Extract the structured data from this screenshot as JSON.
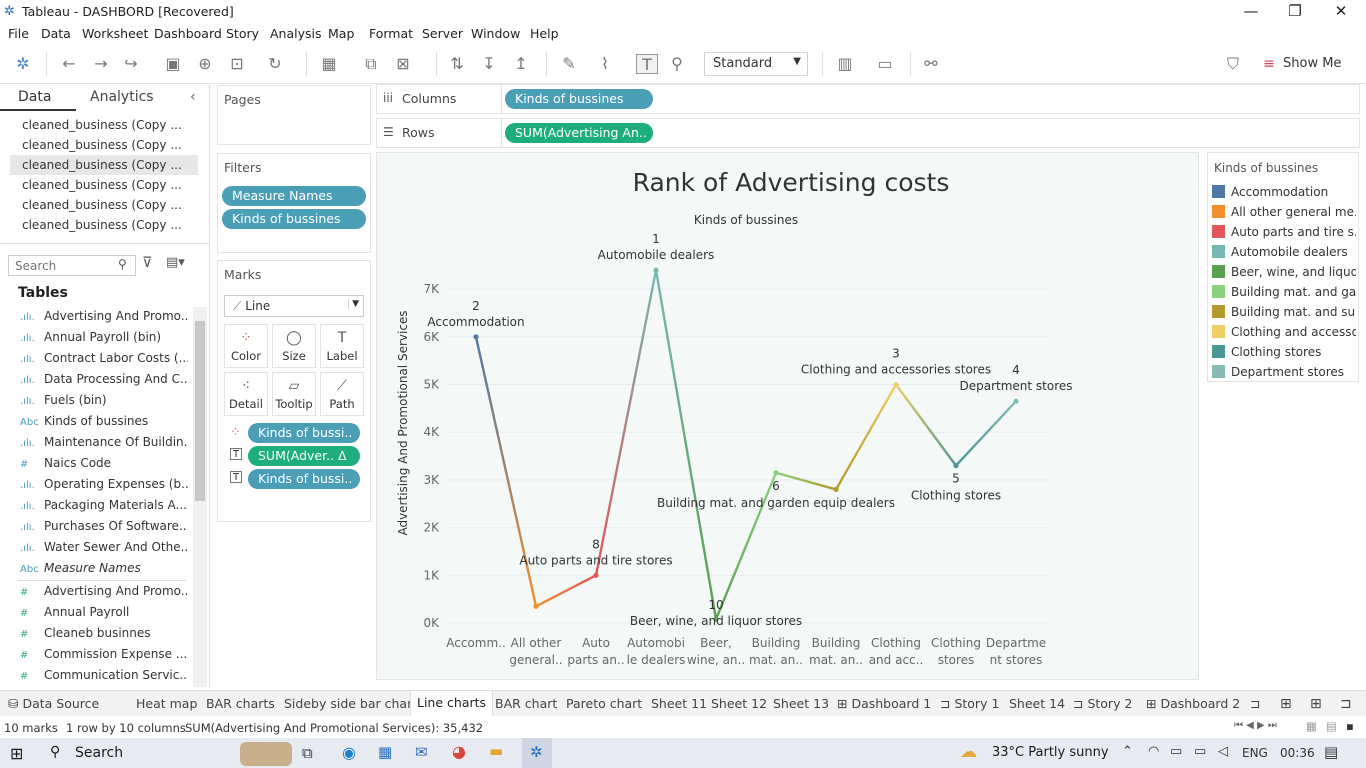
{
  "window": {
    "title": "Tableau - DASHBORD [Recovered]",
    "min": "—",
    "restore": "❐",
    "close": "✕"
  },
  "menu": [
    "File",
    "Data",
    "Worksheet",
    "Dashboard",
    "Story",
    "Analysis",
    "Map",
    "Format",
    "Server",
    "Window",
    "Help"
  ],
  "toolbar": {
    "fit": "Standard",
    "show_me": "Show Me"
  },
  "left": {
    "tab_data": "Data",
    "tab_analytics": "Analytics",
    "datasources": [
      "cleaned_business (Copy ...",
      "cleaned_business (Copy ...",
      "cleaned_business (Copy ...",
      "cleaned_business (Copy ...",
      "cleaned_business (Copy ...",
      "cleaned_business (Copy ..."
    ],
    "search_placeholder": "Search",
    "tables_heading": "Tables",
    "fields": [
      {
        "icon": ".ılı.",
        "label": "Advertising And Promo..."
      },
      {
        "icon": ".ılı.",
        "label": "Annual Payroll (bin)"
      },
      {
        "icon": ".ılı.",
        "label": "Contract Labor Costs (..."
      },
      {
        "icon": ".ılı.",
        "label": "Data Processing And C..."
      },
      {
        "icon": ".ılı.",
        "label": "Fuels (bin)"
      },
      {
        "icon": "Abc",
        "label": "Kinds of bussines"
      },
      {
        "icon": ".ılı.",
        "label": "Maintenance Of Buildin..."
      },
      {
        "icon": "#",
        "label": "Naics Code"
      },
      {
        "icon": ".ılı.",
        "label": "Operating Expenses (b..."
      },
      {
        "icon": ".ılı.",
        "label": "Packaging Materials A..."
      },
      {
        "icon": ".ılı.",
        "label": "Purchases Of Software..."
      },
      {
        "icon": ".ılı.",
        "label": "Water Sewer And Othe..."
      },
      {
        "icon": "Abc",
        "label": "Measure Names"
      }
    ],
    "measures": [
      {
        "icon": "#",
        "label": "Advertising And Promo..."
      },
      {
        "icon": "#",
        "label": "Annual Payroll"
      },
      {
        "icon": "#",
        "label": "Cleaneb businnes"
      },
      {
        "icon": "#",
        "label": "Commission Expense ..."
      },
      {
        "icon": "#",
        "label": "Communication Servic..."
      }
    ]
  },
  "cards": {
    "pages": "Pages",
    "filters": "Filters",
    "filter_pills": [
      "Measure Names",
      "Kinds of bussines"
    ],
    "marks": "Marks",
    "mark_type": "Line",
    "mark_buttons": [
      "Color",
      "Size",
      "Label",
      "Detail",
      "Tooltip",
      "Path"
    ],
    "mark_pills": [
      "Kinds of bussi..",
      "SUM(Adver..  Δ",
      "Kinds of bussi.."
    ]
  },
  "shelves": {
    "columns": "Columns",
    "columns_pill": "Kinds of bussines",
    "rows": "Rows",
    "rows_pill": "SUM(Advertising An.."
  },
  "chart_data": {
    "type": "line",
    "title": "Rank of Advertising costs",
    "subtitle": "Kinds of bussines",
    "ylabel": "Advertising And Promotional Services",
    "ylim": [
      0,
      7800
    ],
    "yticks": [
      "0K",
      "1K",
      "2K",
      "3K",
      "4K",
      "5K",
      "6K",
      "7K"
    ],
    "ytick_values": [
      0,
      1000,
      2000,
      3000,
      4000,
      5000,
      6000,
      7000
    ],
    "categories": [
      "Accommodation",
      "All other general merchandise stores",
      "Auto parts and tire stores",
      "Automobile dealers",
      "Beer, wine, and liquor stores",
      "Building mat. and garden equip dealers",
      "Building mat. and supplies dealers",
      "Clothing and accessories stores",
      "Clothing stores",
      "Department stores"
    ],
    "tick_labels": [
      [
        "Accomm.."
      ],
      [
        "All other",
        "general.."
      ],
      [
        "Auto",
        "parts an.."
      ],
      [
        "Automobi",
        "le dealers"
      ],
      [
        "Beer,",
        "wine, an.."
      ],
      [
        "Building",
        "mat. an.."
      ],
      [
        "Building",
        "mat. an.."
      ],
      [
        "Clothing",
        "and acc.."
      ],
      [
        "Clothing",
        "stores"
      ],
      [
        "Departme",
        "nt stores"
      ]
    ],
    "values": [
      6000,
      350,
      1000,
      7400,
      80,
      3150,
      2800,
      5000,
      3300,
      4650
    ],
    "colors": [
      "#4e79a7",
      "#f28e2b",
      "#e15759",
      "#76b7b2",
      "#59a14f",
      "#8cd17d",
      "#b6992d",
      "#f1ce63",
      "#499894",
      "#86bcb6"
    ],
    "annotations": [
      {
        "i": 0,
        "rank": "2",
        "label": "Accommodation",
        "pos": "above"
      },
      {
        "i": 2,
        "rank": "8",
        "label": "Auto parts and tire stores",
        "pos": "above"
      },
      {
        "i": 3,
        "rank": "1",
        "label": "Automobile dealers",
        "pos": "above"
      },
      {
        "i": 4,
        "rank": "10",
        "label": "Beer, wine, and liquor stores",
        "pos": "below"
      },
      {
        "i": 5,
        "rank": "6",
        "label": "Building mat. and garden equip dealers",
        "pos": "below"
      },
      {
        "i": 7,
        "rank": "3",
        "label": "Clothing and accessories stores",
        "pos": "above"
      },
      {
        "i": 8,
        "rank": "5",
        "label": "Clothing stores",
        "pos": "below"
      },
      {
        "i": 9,
        "rank": "4",
        "label": "Department stores",
        "pos": "above"
      }
    ]
  },
  "legend": {
    "title": "Kinds of bussines",
    "items": [
      {
        "label": "Accommodation",
        "color": "#4e79a7"
      },
      {
        "label": "All other general me..",
        "color": "#f28e2b"
      },
      {
        "label": "Auto parts and tire s..",
        "color": "#e15759"
      },
      {
        "label": "Automobile dealers",
        "color": "#76b7b2"
      },
      {
        "label": "Beer, wine, and liquo..",
        "color": "#59a14f"
      },
      {
        "label": "Building mat. and ga..",
        "color": "#8cd17d"
      },
      {
        "label": "Building mat. and su..",
        "color": "#b6992d"
      },
      {
        "label": "Clothing and accesso..",
        "color": "#f1ce63"
      },
      {
        "label": "Clothing stores",
        "color": "#499894"
      },
      {
        "label": "Department stores",
        "color": "#86bcb6"
      }
    ]
  },
  "sheets": [
    "Data Source",
    "Heat map",
    "BAR charts",
    "Sideby side bar chart",
    "Line charts",
    "BAR chart",
    "Pareto chart",
    "Sheet 11",
    "Sheet 12",
    "Sheet 13",
    "Dashboard 1",
    "Story 1",
    "Sheet 14",
    "Story 2",
    "Dashboard 2"
  ],
  "status": {
    "marks": "10 marks",
    "rows": "1 row by 10 columns",
    "sum": "SUM(Advertising And Promotional Services): 35,432"
  },
  "taskbar": {
    "search": "Search",
    "weather": "33°C  Partly sunny",
    "lang": "ENG",
    "time": "00:36"
  }
}
